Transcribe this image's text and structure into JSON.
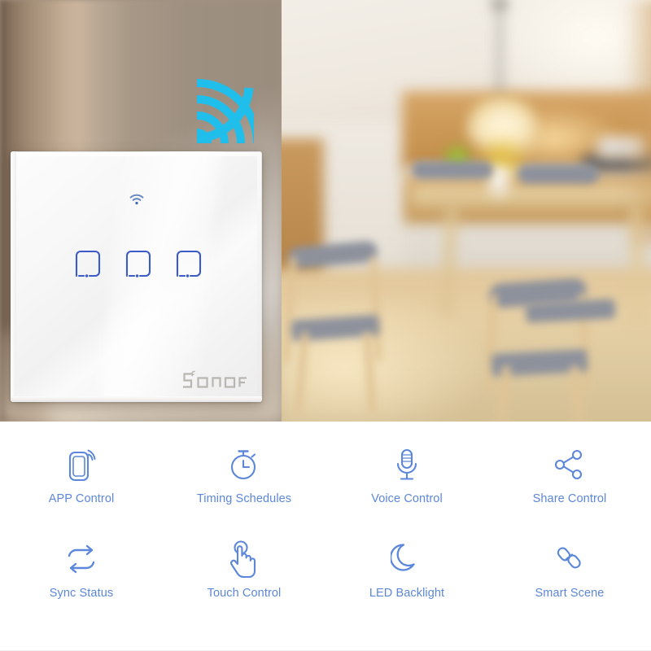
{
  "scene": {
    "type": "product-lifestyle-photo",
    "description": "Blurred kitchen and dining room interior with pendant lamp, wooden cabinets, dining table and chairs",
    "wifi_beam_icon": "wifi-signal-icon",
    "wifi_beam_color": "#20bfeb"
  },
  "device": {
    "brand": "SONOFF",
    "type": "wall-touch-switch",
    "gang_count": 3,
    "panel_color": "#f6f6f6",
    "indicator_icon": "wifi-indicator-icon",
    "button_outline_color": "#3b5bc8",
    "buttons": [
      {
        "name": "touch-button-1",
        "state": "off"
      },
      {
        "name": "touch-button-2",
        "state": "off"
      },
      {
        "name": "touch-button-3",
        "state": "off"
      }
    ]
  },
  "features": {
    "accent_color": "#5c87da",
    "rows": [
      [
        {
          "icon": "phone-app-icon",
          "label": "APP Control"
        },
        {
          "icon": "stopwatch-icon",
          "label": "Timing Schedules"
        },
        {
          "icon": "microphone-icon",
          "label": "Voice Control"
        },
        {
          "icon": "share-nodes-icon",
          "label": "Share Control"
        }
      ],
      [
        {
          "icon": "sync-arrows-icon",
          "label": "Sync Status"
        },
        {
          "icon": "hand-touch-icon",
          "label": "Touch Control"
        },
        {
          "icon": "moon-icon",
          "label": "LED Backlight"
        },
        {
          "icon": "link-chain-icon",
          "label": "Smart Scene"
        }
      ]
    ]
  }
}
